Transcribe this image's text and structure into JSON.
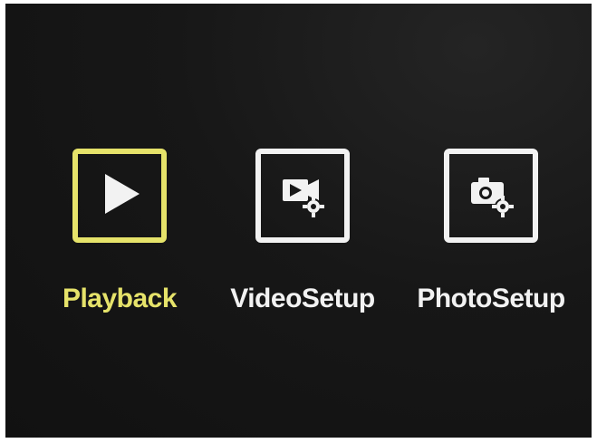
{
  "menu": {
    "selected_index": 0,
    "items": [
      {
        "label": "Playback",
        "icon": "play-icon"
      },
      {
        "label": "VideoSetup",
        "icon": "video-settings-icon"
      },
      {
        "label": "PhotoSetup",
        "icon": "photo-settings-icon"
      }
    ]
  },
  "colors": {
    "background": "#171717",
    "selected": "#e6e36a",
    "normal": "#f2f2f2"
  }
}
